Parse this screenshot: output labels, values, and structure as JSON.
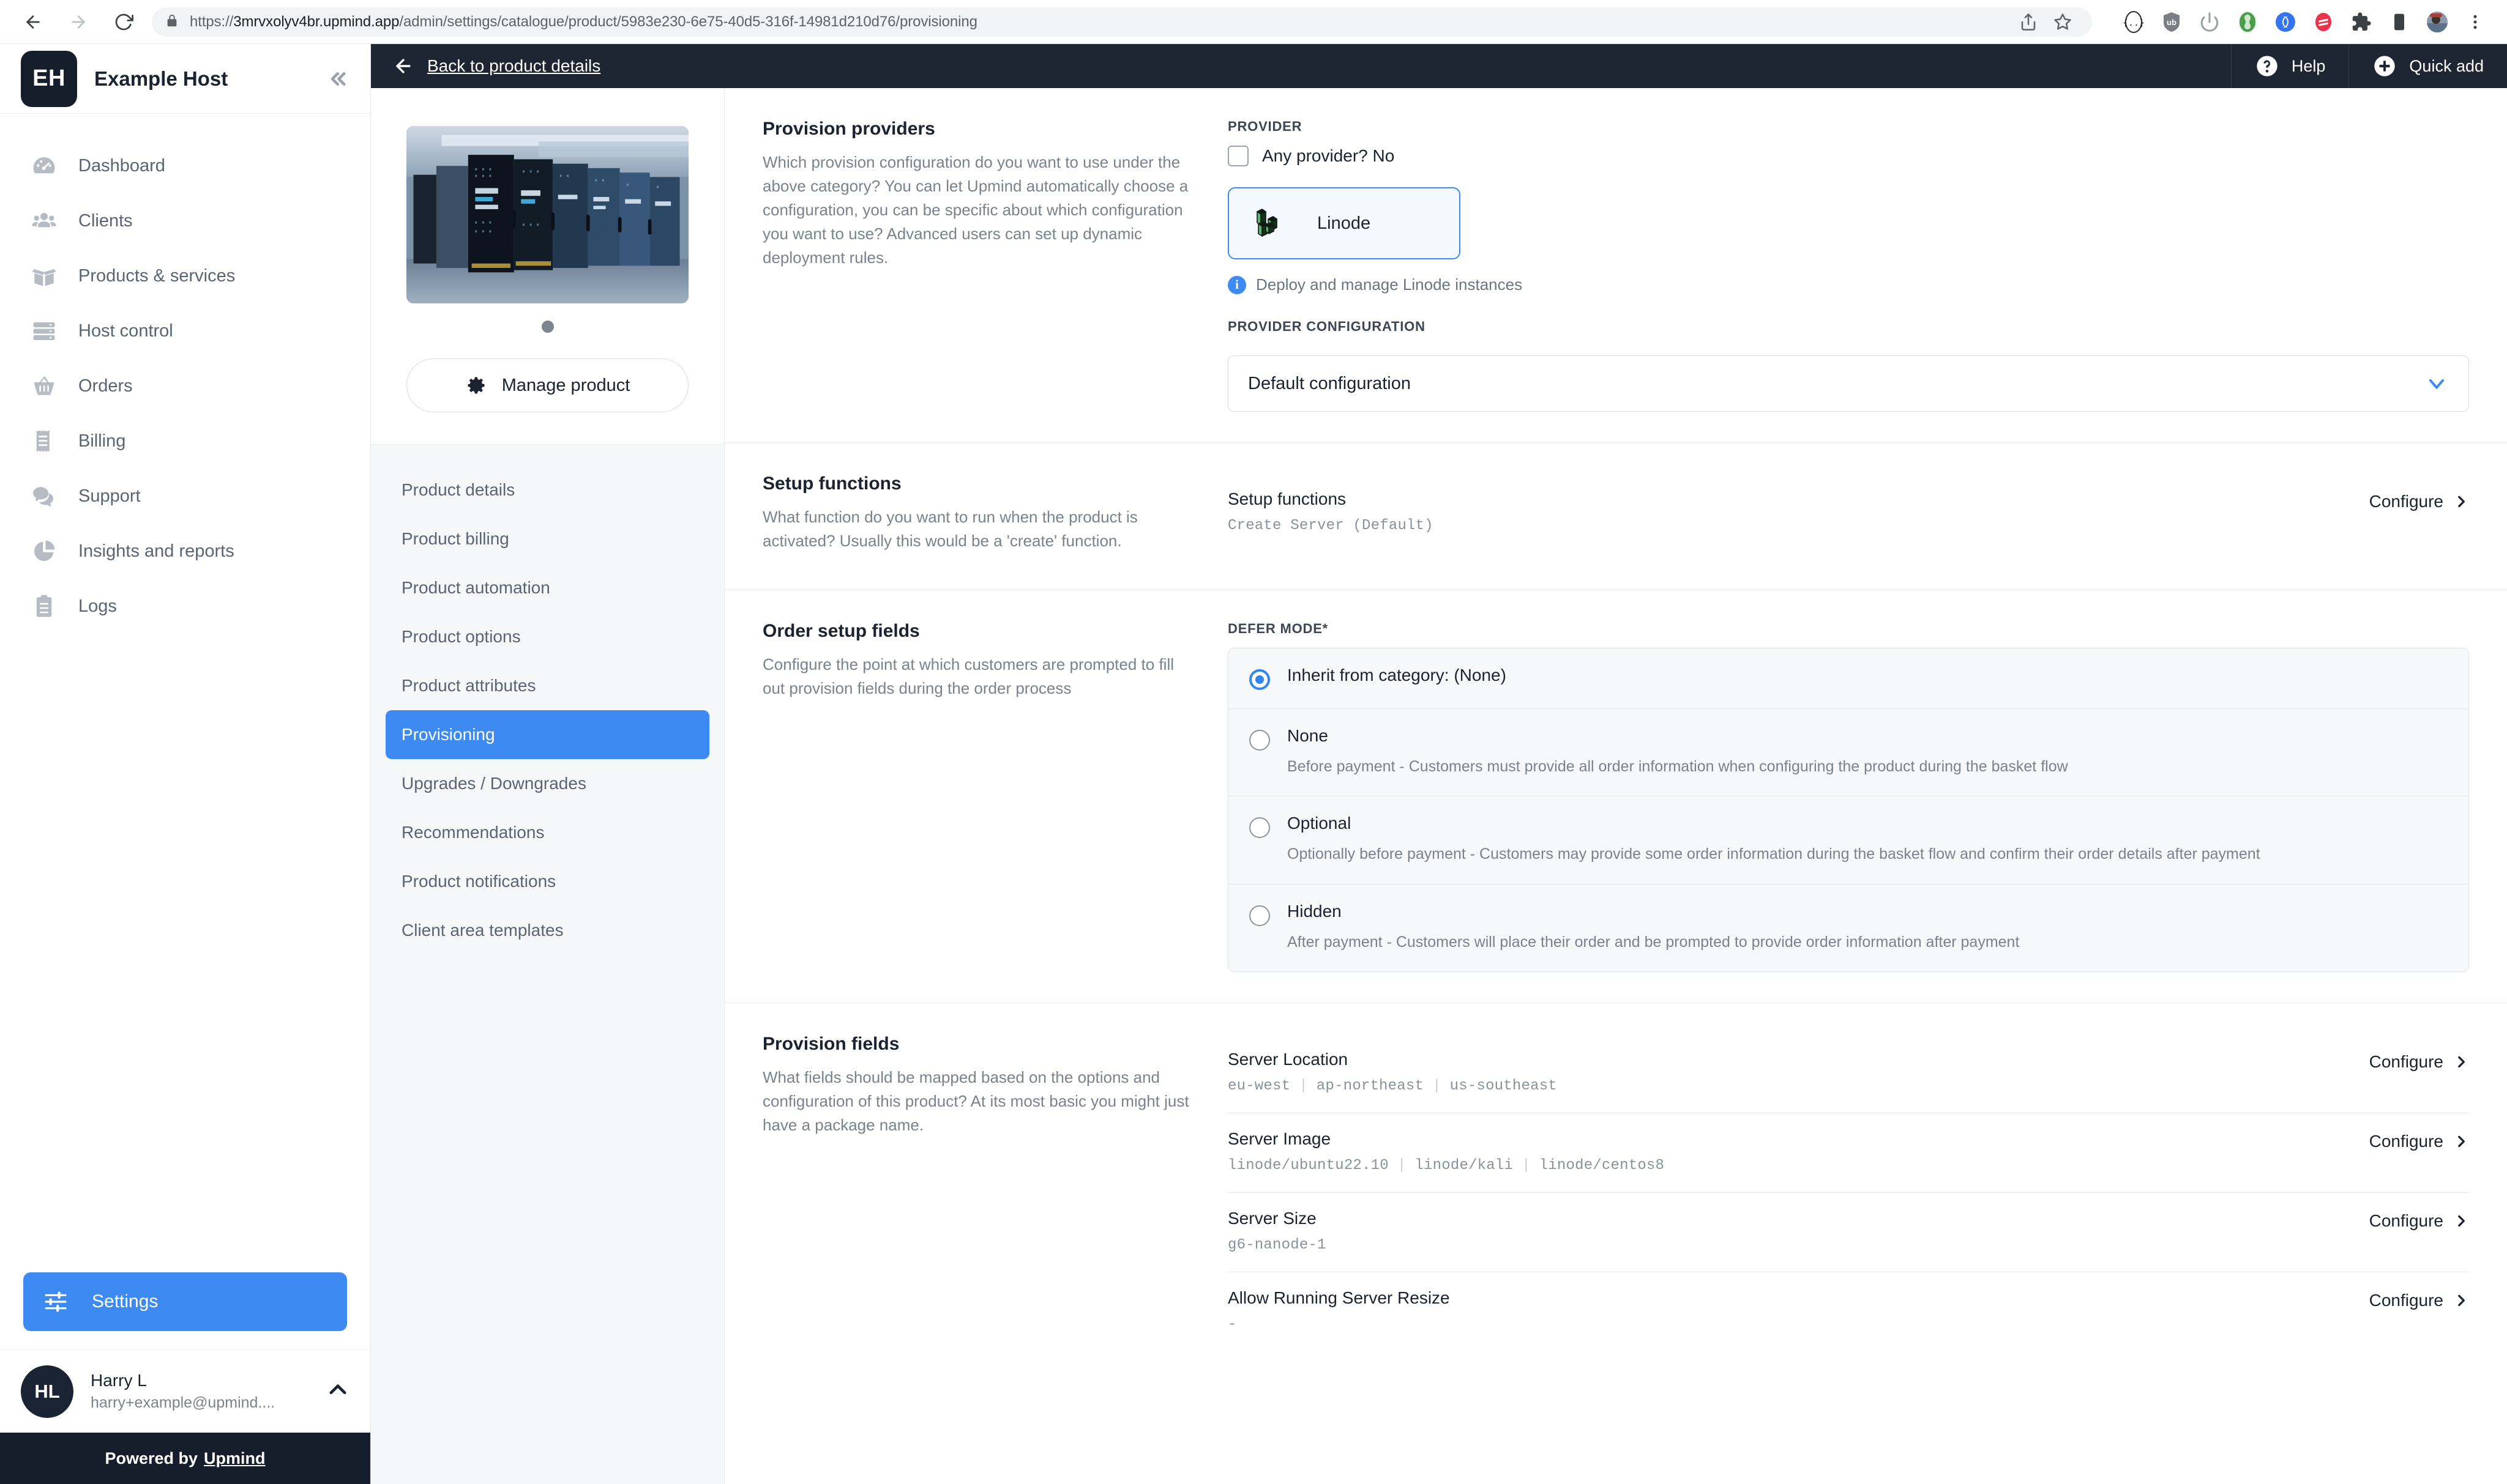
{
  "browser": {
    "url_scheme": "https://",
    "url_host": "3mrvxolyv4br.upmind.app",
    "url_path": "/admin/settings/catalogue/product/5983e230-6e75-40d5-316f-14981d210d76/provisioning"
  },
  "sidebar": {
    "brand_initials": "EH",
    "brand_name": "Example Host",
    "items": [
      {
        "label": "Dashboard",
        "icon": "gauge-icon"
      },
      {
        "label": "Clients",
        "icon": "people-icon"
      },
      {
        "label": "Products & services",
        "icon": "box-icon"
      },
      {
        "label": "Host control",
        "icon": "server-icon"
      },
      {
        "label": "Orders",
        "icon": "basket-icon"
      },
      {
        "label": "Billing",
        "icon": "receipt-icon"
      },
      {
        "label": "Support",
        "icon": "chat-icon"
      },
      {
        "label": "Insights and reports",
        "icon": "pie-chart-icon"
      },
      {
        "label": "Logs",
        "icon": "clipboard-icon"
      }
    ],
    "settings_label": "Settings",
    "user_name": "Harry L",
    "user_email": "harry+example@upmind....",
    "powered_prefix": "Powered by",
    "powered_brand": "Upmind"
  },
  "topbar": {
    "back_label": "Back to product details",
    "help_label": "Help",
    "quick_add_label": "Quick add"
  },
  "product_panel": {
    "manage_label": "Manage product",
    "nav": [
      {
        "label": "Product details",
        "active": false
      },
      {
        "label": "Product billing",
        "active": false
      },
      {
        "label": "Product automation",
        "active": false
      },
      {
        "label": "Product options",
        "active": false
      },
      {
        "label": "Product attributes",
        "active": false
      },
      {
        "label": "Provisioning",
        "active": true
      },
      {
        "label": "Upgrades / Downgrades",
        "active": false
      },
      {
        "label": "Recommendations",
        "active": false
      },
      {
        "label": "Product notifications",
        "active": false
      },
      {
        "label": "Client area templates",
        "active": false
      }
    ]
  },
  "provision_providers": {
    "title": "Provision providers",
    "description": "Which provision configuration do you want to use under the above category? You can let Upmind automatically choose a configuration, you can be specific about which configuration you want to use? Advanced users can set up dynamic deployment rules.",
    "provider_label": "PROVIDER",
    "any_provider_label": "Any provider? No",
    "provider_name": "Linode",
    "provider_hint": "Deploy and manage Linode instances",
    "provider_config_label": "PROVIDER CONFIGURATION",
    "provider_config_value": "Default configuration"
  },
  "setup_functions": {
    "title": "Setup functions",
    "description": "What function do you want to run when the product is activated? Usually this would be a 'create' function.",
    "row_title": "Setup functions",
    "row_value": "Create Server (Default)",
    "configure_label": "Configure"
  },
  "order_setup_fields": {
    "title": "Order setup fields",
    "description": "Configure the point at which customers are prompted to fill out provision fields during the order process",
    "defer_mode_label": "DEFER MODE*",
    "options": [
      {
        "label": "Inherit from category: (None)",
        "desc": "",
        "selected": true
      },
      {
        "label": "None",
        "desc": "Before payment - Customers must provide all order information when configuring the product during the basket flow",
        "selected": false
      },
      {
        "label": "Optional",
        "desc": "Optionally before payment - Customers may provide some order information during the basket flow and confirm their order details after payment",
        "selected": false
      },
      {
        "label": "Hidden",
        "desc": "After payment - Customers will place their order and be prompted to provide order information after payment",
        "selected": false
      }
    ]
  },
  "provision_fields": {
    "title": "Provision fields",
    "description": "What fields should be mapped based on the options and configuration of this product? At its most basic you might just have a package name.",
    "configure_label": "Configure",
    "rows": [
      {
        "title": "Server Location",
        "values": [
          "eu-west",
          "ap-northeast",
          "us-southeast"
        ]
      },
      {
        "title": "Server Image",
        "values": [
          "linode/ubuntu22.10",
          "linode/kali",
          "linode/centos8"
        ]
      },
      {
        "title": "Server Size",
        "values": [
          "g6-nanode-1"
        ]
      },
      {
        "title": "Allow Running Server Resize",
        "values": [
          "-"
        ]
      }
    ]
  },
  "colors": {
    "accent": "#3d8bf2",
    "dark": "#1e2633",
    "panel_bg": "#f6f7f9"
  }
}
